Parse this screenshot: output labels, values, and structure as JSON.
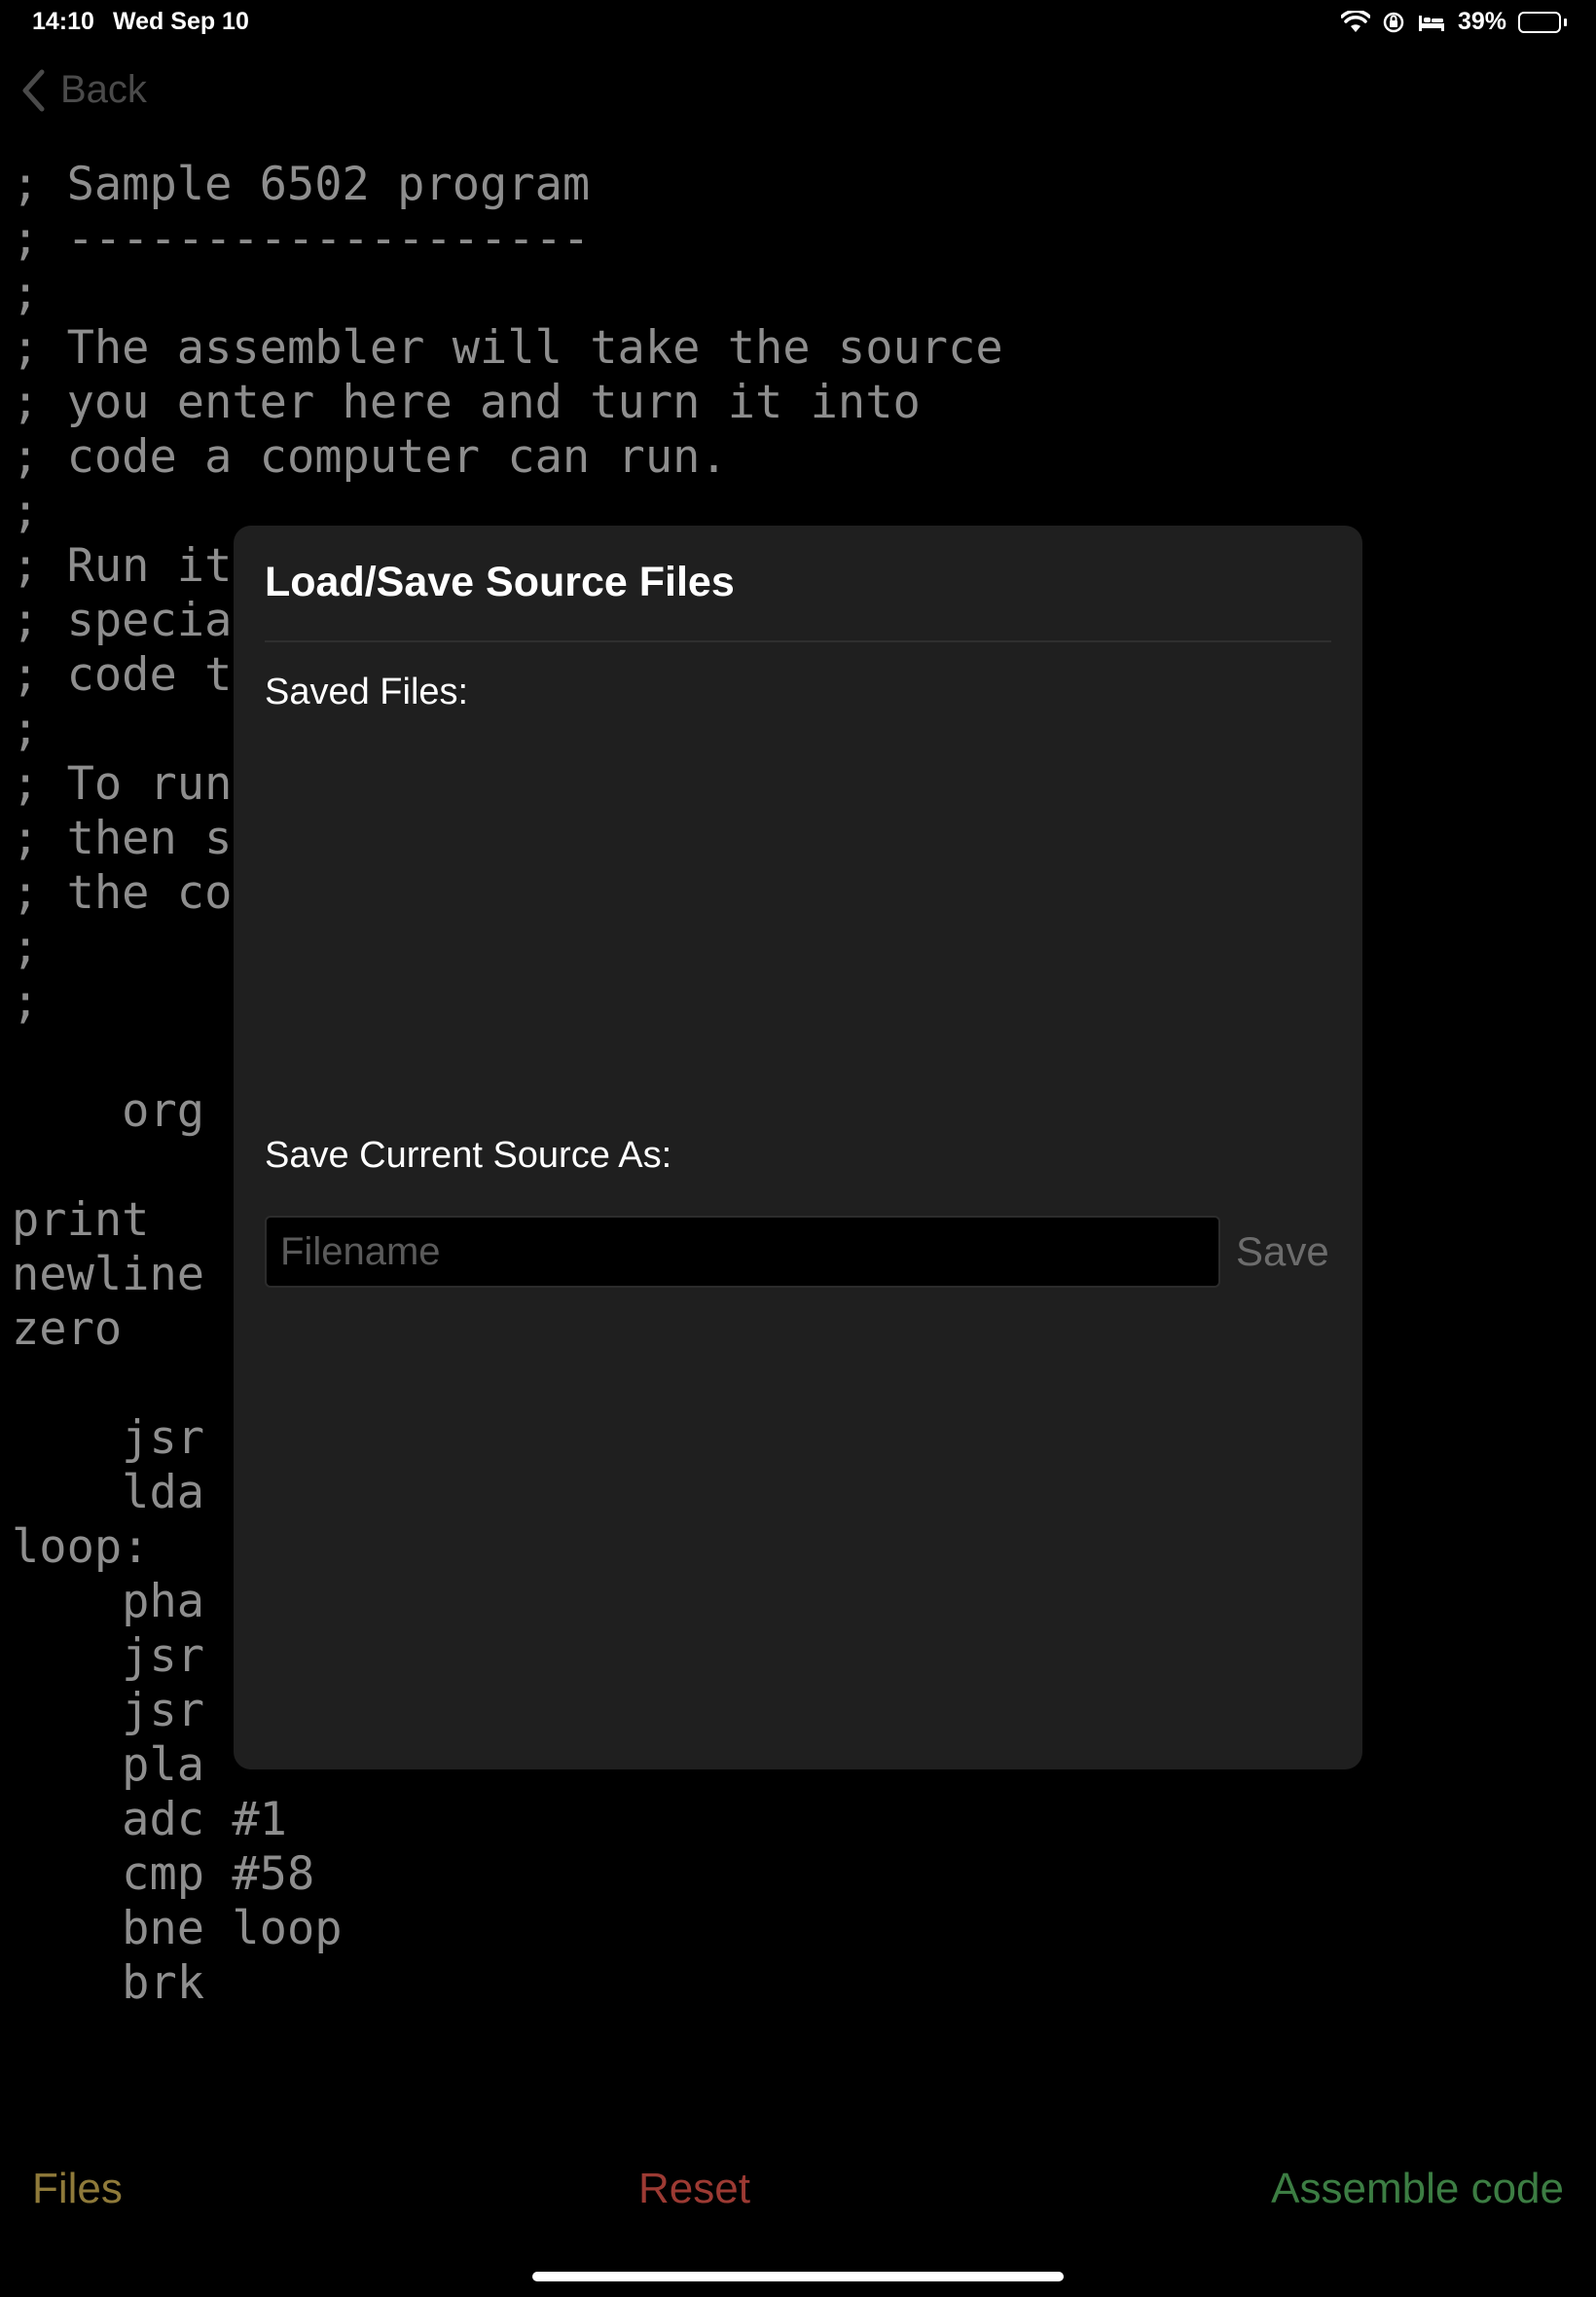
{
  "status_bar": {
    "time": "14:10",
    "date": "Wed Sep 10",
    "battery_percent": "39%",
    "battery_level": 0.39
  },
  "nav": {
    "back_label": "Back"
  },
  "code_lines": [
    "; Sample 6502 program",
    "; -------------------",
    ";",
    "; The assembler will take the source",
    "; you enter here and turn it into",
    "; code a computer can run.",
    ";",
    "; Run it",
    "; specia",
    "; code t",
    ";",
    "; To run",
    "; then s",
    "; the co",
    ";",
    ";",
    "",
    "    org",
    "",
    "print",
    "newline",
    "zero",
    "",
    "    jsr",
    "    lda",
    "loop:",
    "    pha",
    "    jsr",
    "    jsr",
    "    pla",
    "    adc #1",
    "    cmp #58",
    "    bne loop",
    "    brk"
  ],
  "modal": {
    "title": "Load/Save Source Files",
    "saved_files_label": "Saved Files:",
    "saved_files": [],
    "save_as_label": "Save Current Source As:",
    "filename_value": "",
    "filename_placeholder": "Filename",
    "save_label": "Save"
  },
  "toolbar": {
    "files_label": "Files",
    "reset_label": "Reset",
    "assemble_label": "Assemble code"
  },
  "colors": {
    "files": "#8f7a3a",
    "reset": "#9c3a33",
    "assemble": "#3c7d43",
    "code_text": "#8e8e8e",
    "modal_bg": "#1f1f1f"
  }
}
